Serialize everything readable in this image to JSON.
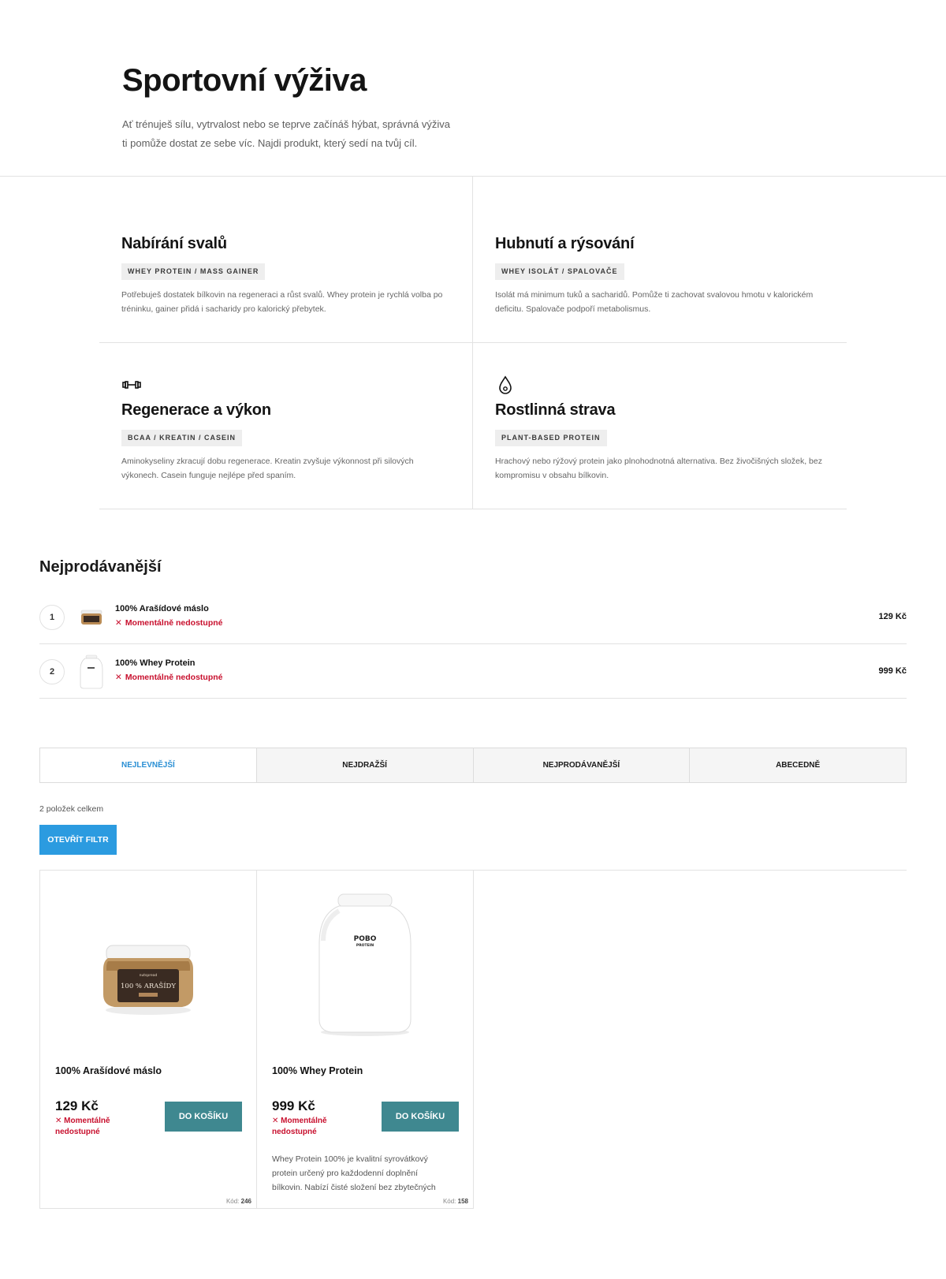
{
  "hero": {
    "title": "Sportovní výživa",
    "intro": "Ať trénuješ sílu, vytrvalost nebo se teprve začínáš hýbat, správná výživa ti pomůže dostat ze sebe víc. Najdi produkt, který sedí na tvůj cíl."
  },
  "goals": [
    {
      "title": "Nabírání svalů",
      "tag": "WHEY PROTEIN / MASS GAINER",
      "desc": "Potřebuješ dostatek bílkovin na regeneraci a růst svalů. Whey protein je rychlá volba po tréninku, gainer přidá i sacharidy pro kalorický přebytek.",
      "icon": "none"
    },
    {
      "title": "Hubnutí a rýsování",
      "tag": "WHEY ISOLÁT / SPALOVAČE",
      "desc": "Isolát má minimum tuků a sacharidů. Pomůže ti zachovat svalovou hmotu v kalorickém deficitu. Spalovače podpoří metabolismus.",
      "icon": "none"
    },
    {
      "title": "Regenerace a výkon",
      "tag": "BCAA / KREATIN / CASEIN",
      "desc": "Aminokyseliny zkracují dobu regenerace. Kreatin zvyšuje výkonnost při silových výkonech. Casein funguje nejlépe před spaním.",
      "icon": "dumbbell-icon"
    },
    {
      "title": "Rostlinná strava",
      "tag": "PLANT-BASED PROTEIN",
      "desc": "Hrachový nebo rýžový protein jako plnohodnotná alternativa. Bez živočišných složek, bez kompromisu v obsahu bílkovin.",
      "icon": "seed-drop-icon"
    }
  ],
  "bestsellers": {
    "title": "Nejprodávanější",
    "items": [
      {
        "rank": "1",
        "name": "100% Arašídové máslo",
        "status": "Momentálně nedostupné",
        "price": "129 Kč",
        "thumb": "peanut-butter-jar"
      },
      {
        "rank": "2",
        "name": "100% Whey Protein",
        "status": "Momentálně nedostupné",
        "price": "999 Kč",
        "thumb": "protein-tub"
      }
    ]
  },
  "sort_tabs": [
    {
      "label": "NEJLEVNĚJŠÍ",
      "active": true
    },
    {
      "label": "NEJDRAŽŠÍ",
      "active": false
    },
    {
      "label": "NEJPRODÁVANĚJŠÍ",
      "active": false
    },
    {
      "label": "ABECEDNĚ",
      "active": false
    }
  ],
  "listing": {
    "count": "2 položek celkem",
    "filter_button": "OTEVŘÍT FILTR"
  },
  "products": [
    {
      "name": "100% Arašídové máslo",
      "price": "129 Kč",
      "status": "Momentálně nedostupné",
      "cart_button": "DO KOŠÍKU",
      "description": "",
      "code_label": "Kód:",
      "code": "246",
      "image": "peanut-butter-jar",
      "jar_brand": "nutspread",
      "jar_label": "100 % ARAŠÍDY"
    },
    {
      "name": "100% Whey Protein",
      "price": "999 Kč",
      "status": "Momentálně nedostupné",
      "cart_button": "DO KOŠÍKU",
      "description": "Whey Protein 100% je kvalitní syrovátkový protein určený pro každodenní doplnění bílkovin. Nabízí čisté složení bez zbytečných",
      "code_label": "Kód:",
      "code": "158",
      "image": "protein-tub",
      "tub_brand": "POBO",
      "tub_sub": "PROTEIN"
    }
  ],
  "colors": {
    "accent_blue": "#2b9be0",
    "active_tab": "#2a8fd4",
    "cart_teal": "#3f8890",
    "unavailable_red": "#c8102e"
  }
}
